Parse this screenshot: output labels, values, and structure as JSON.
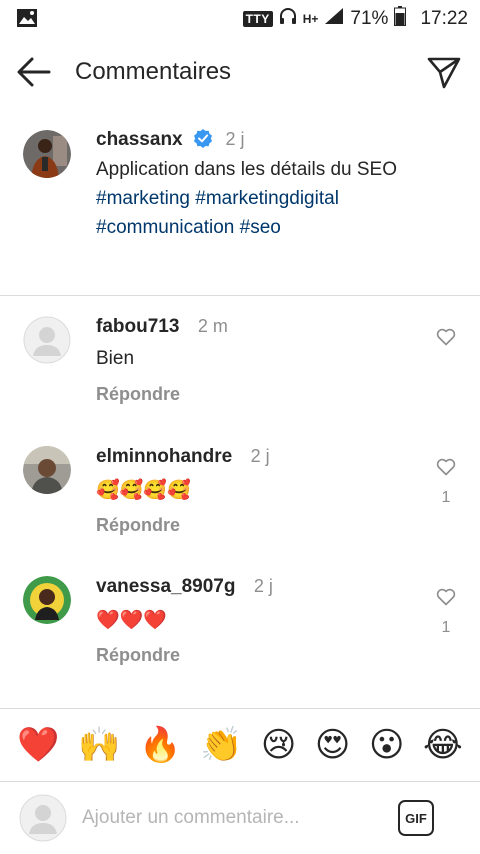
{
  "status_bar": {
    "tty": "TTY",
    "network": "H+",
    "battery": "71%",
    "time": "17:22"
  },
  "header": {
    "title": "Commentaires"
  },
  "caption": {
    "username": "chassanx",
    "time": "2 j",
    "text": "Application dans les détails du SEO",
    "hashtags": [
      "#marketing",
      "#marketingdigital",
      "#communication",
      "#seo"
    ]
  },
  "comments": [
    {
      "username": "fabou713",
      "time": "2 m",
      "text": "Bien",
      "reply_label": "Répondre",
      "likes": ""
    },
    {
      "username": "elminnohandre",
      "time": "2 j",
      "text": "🥰🥰🥰🥰",
      "reply_label": "Répondre",
      "likes": "1"
    },
    {
      "username": "vanessa_8907g",
      "time": "2 j",
      "text": "❤️❤️❤️",
      "reply_label": "Répondre",
      "likes": "1"
    }
  ],
  "emoji_bar": [
    "❤️",
    "🙌",
    "🔥",
    "👏",
    "😢",
    "😍",
    "😮",
    "😂"
  ],
  "input": {
    "placeholder": "Ajouter un commentaire...",
    "value": "",
    "gif_label": "GIF"
  },
  "colors": {
    "text": "#262626",
    "secondary": "#8e8e8e",
    "hashtag": "#00376b",
    "verified": "#3897f0",
    "divider": "#dbdbdb"
  }
}
